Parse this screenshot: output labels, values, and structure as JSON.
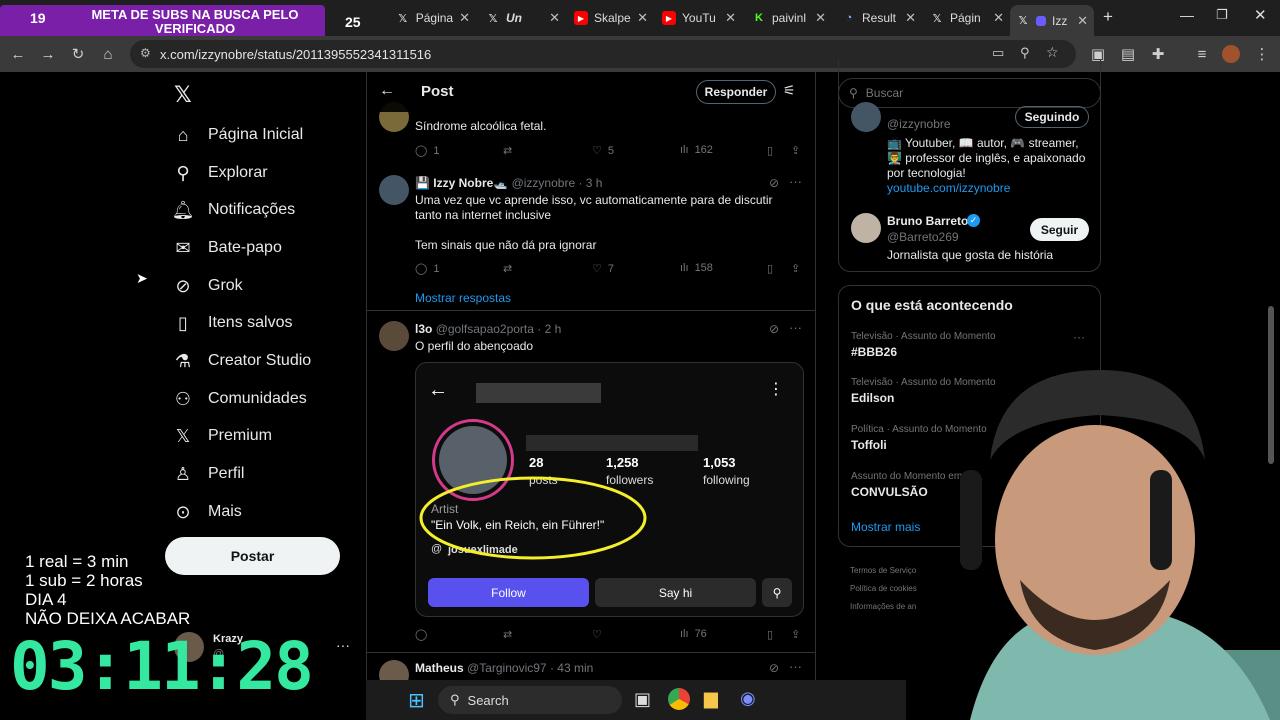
{
  "browser": {
    "tabs": [
      {
        "label": "Página",
        "favicon": "x-icon"
      },
      {
        "label": "Un",
        "favicon": "x-icon"
      },
      {
        "label": "Skalpe",
        "favicon": "youtube-icon"
      },
      {
        "label": "YouTu",
        "favicon": "youtube-icon"
      },
      {
        "label": "paivinl",
        "favicon": "kick-icon"
      },
      {
        "label": "Result",
        "favicon": "chart-icon"
      },
      {
        "label": "Págin",
        "favicon": "x-icon"
      },
      {
        "label": "Izz",
        "favicon": "x-icon"
      }
    ],
    "url": "x.com/izzynobre/status/2011395552341311516"
  },
  "overlay": {
    "banner_text": "META DE SUBS NA BUSCA PELO VERIFICADO",
    "banner_count_left": "19",
    "banner_count_right": "25",
    "lines": [
      "1 real = 3 min",
      "1 sub = 2 horas",
      "DIA 4",
      "NÃO DEIXA ACABAR"
    ],
    "timer": "03:11:28"
  },
  "sidebar": {
    "items": [
      {
        "label": "Página Inicial",
        "icon": "home-icon"
      },
      {
        "label": "Explorar",
        "icon": "search-icon"
      },
      {
        "label": "Notificações",
        "icon": "bell-icon"
      },
      {
        "label": "Bate-papo",
        "icon": "mail-icon"
      },
      {
        "label": "Grok",
        "icon": "grok-icon"
      },
      {
        "label": "Itens salvos",
        "icon": "bookmark-icon"
      },
      {
        "label": "Creator Studio",
        "icon": "flask-icon"
      },
      {
        "label": "Comunidades",
        "icon": "people-icon"
      },
      {
        "label": "Premium",
        "icon": "x-icon"
      },
      {
        "label": "Perfil",
        "icon": "person-icon"
      },
      {
        "label": "Mais",
        "icon": "more-icon"
      }
    ],
    "post_label": "Postar",
    "account_name": "Krazy",
    "account_handle": "@"
  },
  "post": {
    "header_title": "Post",
    "reply_label": "Responder",
    "tweets": [
      {
        "text": "Síndrome alcoólica fetal.",
        "replies": "1",
        "likes": "5",
        "views": "162"
      },
      {
        "name": "💾 Izzy Nobre🛥️",
        "handle": "@izzynobre",
        "time": "· 3 h",
        "text1": "Uma vez que vc aprende isso, vc automaticamente para de discutir tanto na internet inclusive",
        "text2": "Tem sinais que não dá pra ignorar",
        "replies": "1",
        "likes": "7",
        "views": "158"
      },
      {
        "name": "l3o",
        "handle": "@golfsapao2porta",
        "time": "· 2 h",
        "text": "O perfil do abençoado",
        "views": "76"
      },
      {
        "name": "Matheus",
        "handle": "@Targinovic97",
        "time": "· 43 min"
      }
    ],
    "show_replies": "Mostrar respostas",
    "embed": {
      "posts": "28",
      "posts_label": "posts",
      "followers": "1,258",
      "followers_label": "followers",
      "following": "1,053",
      "following_label": "following",
      "bio_title": "Artist",
      "bio_quote": "\"Ein Volk, ein Reich, ein Führer!\"",
      "handle": "josuexlimade",
      "follow": "Follow",
      "say_hi": "Say hi"
    }
  },
  "right": {
    "search_placeholder": "Buscar",
    "profile": {
      "handle": "@izzynobre",
      "following_label": "Seguindo",
      "bio": "📺 Youtuber, 📖 autor, 🎮 streamer, 👨‍🏫 professor de inglês, e apaixonado por tecnologia!",
      "link": "youtube.com/izzynobre"
    },
    "suggest": {
      "name": "Bruno Barreto",
      "handle": "@Barreto269",
      "bio": "Jornalista que gosta de história",
      "follow_label": "Seguir"
    },
    "trends_title": "O que está acontecendo",
    "trends": [
      {
        "category": "Televisão · Assunto do Momento",
        "name": "#BBB26"
      },
      {
        "category": "Televisão · Assunto do Momento",
        "name": "Edilson"
      },
      {
        "category": "Política · Assunto do Momento",
        "name": "Toffoli"
      },
      {
        "category": "Assunto do Momento em",
        "name": "CONVULSÃO"
      }
    ],
    "show_more": "Mostrar mais",
    "footer": [
      "Termos de Serviço",
      "Política de cookies",
      "Informações de an"
    ]
  },
  "taskbar": {
    "search": "Search"
  },
  "colors": {
    "accent": "#1d9bf0",
    "follow_purple": "#5851ee",
    "timer": "#34e8a0",
    "banner": "#7a1fa8"
  }
}
